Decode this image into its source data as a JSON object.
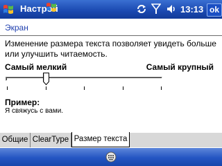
{
  "titlebar": {
    "title": "Настрой",
    "time": "13:13",
    "ok_label": "ok",
    "icons": [
      "windows-flag-icon",
      "sync-icon",
      "signal-icon",
      "volume-icon"
    ]
  },
  "page": {
    "title": "Экран",
    "description": "Изменение размера текста позволяет увидеть больше или улучшить читаемость.",
    "slider": {
      "min_label": "Самый мелкий",
      "max_label": "Самый крупный",
      "positions": 5,
      "selected_index": 1
    },
    "sample_label": "Пример:",
    "sample_text": "Я свяжусь с вами."
  },
  "tabs": [
    {
      "label": "Общие",
      "active": false
    },
    {
      "label": "ClearType",
      "active": false
    },
    {
      "label": "Размер текста",
      "active": true
    }
  ],
  "colors": {
    "titlebar": "#1a48b0",
    "heading": "#1f3fae",
    "tab_inactive": "#d8d8d8"
  }
}
